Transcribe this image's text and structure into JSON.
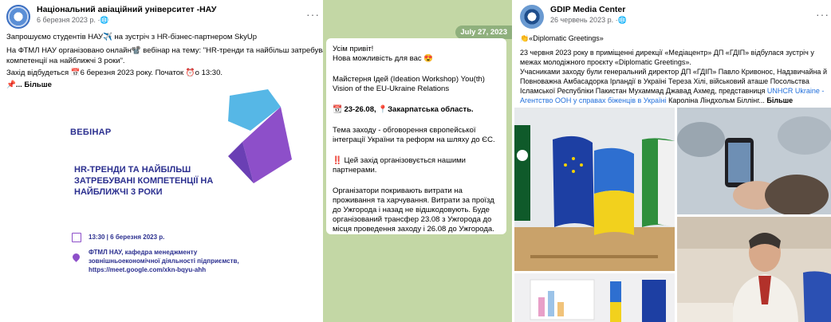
{
  "post1": {
    "page_name": "Національний авіаційний університет -НАУ",
    "date": "6 березня 2023 р. ·",
    "lines": [
      "Запрошуємо студентів НАУ✈️ на зустріч з HR-бізнес-партнером SkyUp",
      " На ФТМЛ НАУ організовано онлайн📽️ вебінар на тему: \"HR-тренди та найбільш затребувані",
      "компетенції на найближчі 3 роки\".",
      "Захід відбудеться 📅6 березня 2023 року. Початок ⏰о 13:30."
    ],
    "more": "📌... Більше",
    "webinar": {
      "label": "ВЕБІНАР",
      "heading": "HR-ТРЕНДИ ТА НАЙБІЛЬШ ЗАТРЕБУВАНІ КОМПЕТЕНЦІЇ НА НАЙБЛИЖЧІ 3 РОКИ",
      "datetime": "13:30 | 6 березня 2023 р.",
      "org_line1": "ФТМЛ НАУ, кафедра менеджменту",
      "org_line2": "зовнішньоекономічної діяльності підприємств,",
      "org_line3": "https://meet.google.com/xkn-bqyu-ahh"
    }
  },
  "post2": {
    "date": "July 27, 2023",
    "lines": [
      "Усім привіт!",
      "Нова можливість для вас 😍",
      "",
      "Майстерня Ідей (Ideation Workshop) You(th)",
      "Vision of the EU-Ukraine Relations",
      "",
      "📆 23-26.08, 📍Закарпатська область.",
      "",
      "Тема заходу - обговорення європейської",
      "інтеграції України та реформ на шляху до ЄС.",
      "",
      "‼️ Цей захід організовується нашими",
      "партнерами.",
      "",
      "Організатори покривають витрати на",
      "проживання та харчування. Витрати за проїзд",
      "до Ужгорода і назад не відшкодовують. Буде",
      "організований трансфер 23.08 з Ужгорода до",
      "місця проведення заходу і 26.08 до Ужгорода."
    ]
  },
  "post3": {
    "page_name": "GDIP Media Center",
    "date": "26 червень 2023 р. ·",
    "greeting": "👏«Diplomatic Greetings»",
    "lines": [
      "23 червня 2023 року в приміщенні дирекції «Медіацентр» ДП «ГДІП» відбулася зустріч у",
      "межах молодіжного проєкту «Diplomatic Greetings».",
      "Учасниками заходу були генеральний директор ДП «ГДІП» Павло Кривонос, Надзвичайна й",
      "Повноважна Амбасадорка Ірландії в Україні Тереза Хілі, військовий аташе Посольства",
      "Ісламської Республіки Пакистан Мухаммад Джавад Ахмед, представниця"
    ],
    "link_part": "UNHCR Ukraine -",
    "line6_link": "Агентство ООН у справах біженців в Україні",
    "line6_rest": " Кароліна Ліндхольм Біллінг... ",
    "more": "Більше"
  },
  "more_icon": "more-horizontal-icon",
  "colors": {
    "fb_link": "#216fdb",
    "webinar_blue": "#2b2f8f",
    "tg_bg": "#c3d7a5",
    "tg_date": "#8fb07d"
  }
}
